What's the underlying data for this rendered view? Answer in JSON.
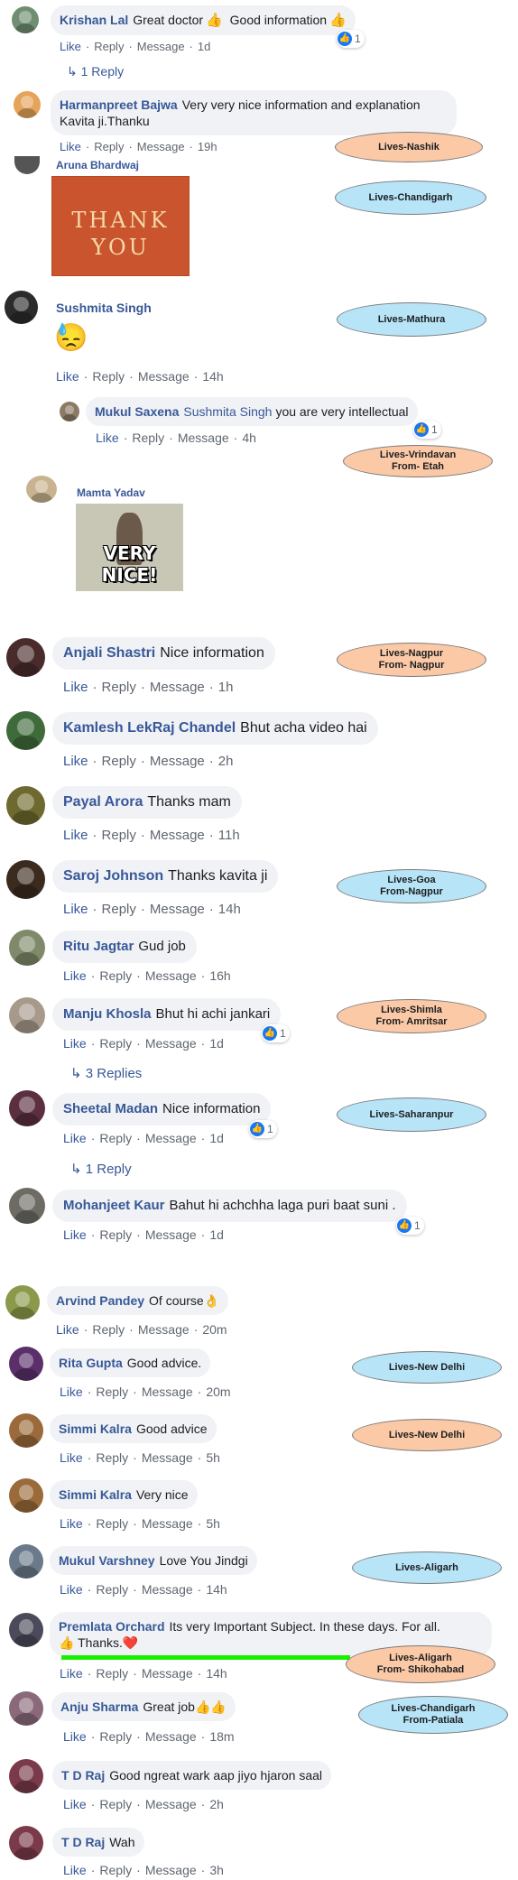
{
  "actions": {
    "like": "Like",
    "reply": "Reply",
    "message": "Message"
  },
  "comments": [
    {
      "name": "Krishan Lal",
      "text": "Great doctor",
      "emoji": "👍",
      "emoji2": "👍",
      "text2": "Good information",
      "time": "1d",
      "reactions": "1",
      "replies": "1 Reply"
    },
    {
      "name": "Harmanpreet Bajwa",
      "text": "Very very nice information and explanation",
      "text_line2": "Kavita ji.Thanku",
      "time": "19h"
    },
    {
      "name": "Aruna Bhardwaj",
      "image_text_top": "THANK",
      "image_text_bottom": "YOU"
    },
    {
      "name": "Sushmita Singh",
      "emoji": "😓",
      "time": "14h"
    },
    {
      "name": "Mukul Saxena",
      "mention": "Sushmita Singh",
      "text": "you are very intellectual",
      "time": "4h",
      "reactions": "1"
    },
    {
      "name": "Mamta Yadav",
      "image_caption": "VERY NICE!"
    },
    {
      "name": "Anjali Shastri",
      "text": "Nice information",
      "time": "1h"
    },
    {
      "name": "Kamlesh LekRaj Chandel",
      "text": "Bhut acha video hai",
      "time": "2h"
    },
    {
      "name": "Payal Arora",
      "text": "Thanks mam",
      "time": "11h"
    },
    {
      "name": "Saroj Johnson",
      "text": "Thanks kavita ji",
      "time": "14h"
    },
    {
      "name": "Ritu Jagtar",
      "text": "Gud job",
      "time": "16h"
    },
    {
      "name": "Manju Khosla",
      "text": "Bhut hi achi jankari",
      "time": "1d",
      "reactions": "1",
      "replies": "3 Replies"
    },
    {
      "name": "Sheetal Madan",
      "text": "Nice information",
      "time": "1d",
      "reactions": "1",
      "replies": "1 Reply"
    },
    {
      "name": "Mohanjeet Kaur",
      "text": "Bahut hi achchha laga puri baat suni .",
      "time": "1d",
      "reactions": "1"
    },
    {
      "name": "Arvind Pandey",
      "text": "Of course",
      "emoji": "👌",
      "time": "20m"
    },
    {
      "name": "Rita Gupta",
      "text": "Good advice.",
      "time": "20m"
    },
    {
      "name": "Simmi Kalra",
      "text": "Good advice",
      "time": "5h"
    },
    {
      "name": "Simmi Kalra",
      "text": "Very nice",
      "time": "5h"
    },
    {
      "name": "Mukul Varshney",
      "text": "Love You Jindgi",
      "time": "14h"
    },
    {
      "name": "Premlata Orchard",
      "text": "Its very Important Subject. In these days. For all.",
      "emoji": "👍",
      "text_line2": "Thanks.",
      "emoji2": "❤️",
      "time": "14h"
    },
    {
      "name": "Anju Sharma",
      "text": "Great job",
      "emoji": "👍👍",
      "time": "18m"
    },
    {
      "name": "T D Raj",
      "text": "Good ngreat wark aap jiyo hjaron saal",
      "time": "2h"
    },
    {
      "name": "T D Raj",
      "text": "Wah",
      "time": "3h"
    }
  ],
  "tags": [
    {
      "line1": "Lives-Nashik",
      "color": "orange"
    },
    {
      "line1": "Lives-Chandigarh",
      "color": "blue"
    },
    {
      "line1": "Lives-Mathura",
      "color": "blue"
    },
    {
      "line1": "Lives-Vrindavan",
      "line2": "From- Etah",
      "color": "orange"
    },
    {
      "line1": "Lives-Nagpur",
      "line2": "From- Nagpur",
      "color": "orange"
    },
    {
      "line1": "Lives-Goa",
      "line2": "From-Nagpur",
      "color": "blue"
    },
    {
      "line1": "Lives-Shimla",
      "line2": "From- Amritsar",
      "color": "orange"
    },
    {
      "line1": "Lives-Saharanpur",
      "color": "blue"
    },
    {
      "line1": "Lives-New Delhi",
      "color": "blue"
    },
    {
      "line1": "Lives-New Delhi",
      "color": "orange"
    },
    {
      "line1": "Lives-Aligarh",
      "color": "blue"
    },
    {
      "line1": "Lives-Aligarh",
      "line2": "From- Shikohabad",
      "color": "orange"
    },
    {
      "line1": "Lives-Chandigarh",
      "line2": "From-Patiala",
      "color": "blue"
    }
  ],
  "colors": {
    "name": "#385898",
    "bubble": "#f0f2f5",
    "meta": "#606770",
    "like": "#1877f2",
    "tag_blue": "#b7e4f6",
    "tag_orange": "#fbc9a6",
    "highlight": "#18f000"
  },
  "icons": {
    "like": "thumbs-up-icon",
    "reply_arrow": "reply-arrow-icon"
  }
}
